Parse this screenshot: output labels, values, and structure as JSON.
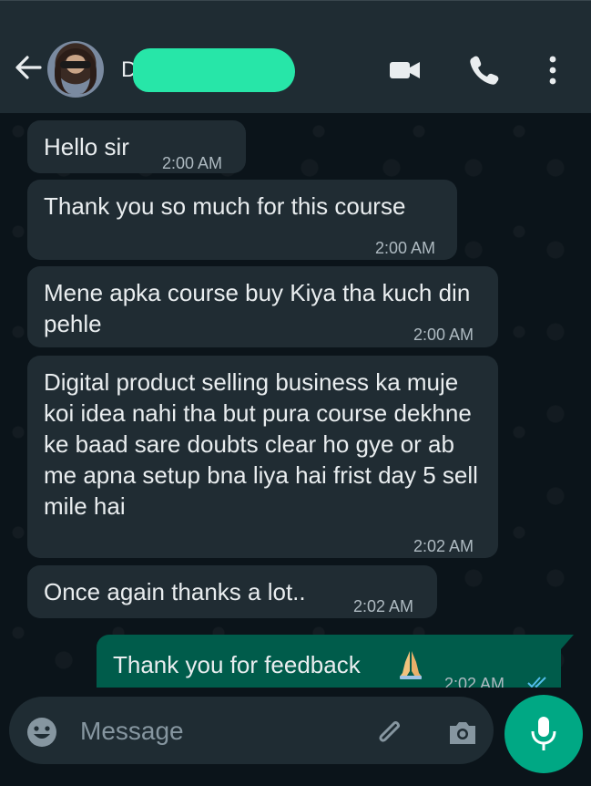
{
  "header": {
    "contact_initial": "D",
    "icons": [
      "back-arrow-icon",
      "video-call-icon",
      "phone-icon",
      "more-vertical-icon"
    ]
  },
  "messages": [
    {
      "text": "Hello sir",
      "time": "2:00 AM",
      "direction": "incoming"
    },
    {
      "text": "Thank you so much for this course",
      "time": "2:00 AM",
      "direction": "incoming"
    },
    {
      "text": "Mene apka course buy Kiya tha kuch din pehle",
      "time": "2:00 AM",
      "direction": "incoming"
    },
    {
      "text": "Digital product selling business ka muje koi idea nahi tha but pura course dekhne ke baad sare doubts clear ho gye or ab me apna setup bna liya hai frist day 5 sell mile hai",
      "time": "2:02 AM",
      "direction": "incoming"
    },
    {
      "text": "Once again thanks a lot..",
      "time": "2:02 AM",
      "direction": "incoming"
    },
    {
      "text": "Thank you for feedback",
      "time": "2:02 AM",
      "direction": "outgoing",
      "emoji": "folded-hands-icon"
    }
  ],
  "composer": {
    "placeholder": "Message",
    "icons": [
      "emoji-icon",
      "attach-icon",
      "camera-icon",
      "mic-icon"
    ]
  },
  "colors": {
    "header_bg": "#1f2c33",
    "chat_bg": "#0b141a",
    "incoming_bubble": "#202c33",
    "outgoing_bubble": "#005c4b",
    "accent": "#00a884",
    "redaction": "#27e6a8"
  }
}
